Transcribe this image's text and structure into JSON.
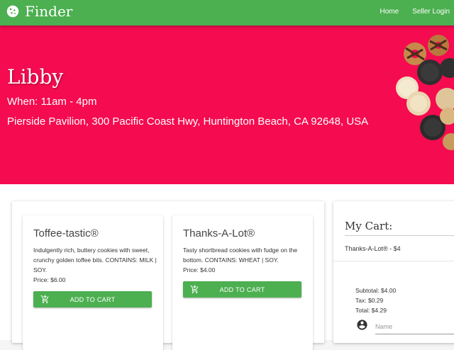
{
  "navbar": {
    "brand_name": "Finder",
    "brand_icon": "cookie-icon",
    "links": [
      {
        "label": "Home"
      },
      {
        "label": "Seller Login"
      }
    ],
    "color": "#4caf50"
  },
  "hero": {
    "seller_name": "Libby",
    "when": "When: 11am - 4pm",
    "address": "Pierside Pavilion, 300 Pacific Coast Hwy, Huntington Beach, CA 92648, USA",
    "background_color": "#f50b4f",
    "image": "cookie-assortment-photo"
  },
  "products": [
    {
      "name": "Toffee-tastic®",
      "description": "Indulgently rich, buttery cookies with sweet, crunchy golden toffee bits. CONTAINS: MILK | SOY.",
      "price": "Price: $6.00",
      "button_label": "ADD TO CART",
      "button_icon": "add-shopping-cart-icon"
    },
    {
      "name": "Thanks-A-Lot®",
      "description": "Tasty shortbread cookies with fudge on the bottom. CONTAINS: WHEAT | SOY.",
      "price": "Price: $4.00",
      "button_label": "ADD TO CART",
      "button_icon": "add-shopping-cart-icon"
    }
  ],
  "cart": {
    "title": "My Cart:",
    "items": [
      {
        "label": "Thanks-A-Lot® - $4"
      }
    ],
    "subtotal": "Subtotal: $4.00",
    "tax": "Tax: $0.29",
    "total": "Total: $4.29",
    "name_placeholder": "Name",
    "name_icon": "account-circle-icon"
  },
  "colors": {
    "accent_green": "#4caf50",
    "hero_pink": "#f50b4f"
  }
}
